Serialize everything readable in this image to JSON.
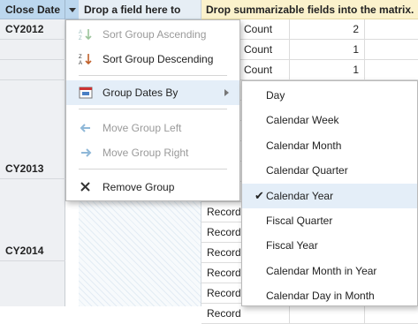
{
  "header": {
    "close_date": "Close Date",
    "drop_field": "Drop a field here to",
    "drop_summarizable": "Drop summarizable fields into the matrix."
  },
  "years": [
    "CY2012",
    "CY2013",
    "CY2014"
  ],
  "records": [
    {
      "label": "Record Count",
      "value": "2"
    },
    {
      "label": "Record Count",
      "value": "1"
    },
    {
      "label": "Record Count",
      "value": "1"
    },
    {
      "label": "Record Count",
      "value": ""
    },
    {
      "label": "Record Count",
      "value": ""
    },
    {
      "label": "Record Count",
      "value": ""
    },
    {
      "label": "Record Count",
      "value": ""
    },
    {
      "label": "Record Count",
      "value": ""
    },
    {
      "label": "Record Count",
      "value": ""
    },
    {
      "label": "Record Count",
      "value": ""
    },
    {
      "label": "Record",
      "value": ""
    },
    {
      "label": "Record",
      "value": ""
    },
    {
      "label": "Record",
      "value": ""
    },
    {
      "label": "Record",
      "value": ""
    },
    {
      "label": "Record",
      "value": ""
    }
  ],
  "context_menu": {
    "sort_asc": "Sort Group Ascending",
    "sort_desc": "Sort Group Descending",
    "group_dates_by": "Group Dates By",
    "move_left": "Move Group Left",
    "move_right": "Move Group Right",
    "remove": "Remove Group"
  },
  "submenu": {
    "items": [
      "Day",
      "Calendar Week",
      "Calendar Month",
      "Calendar Quarter",
      "Calendar Year",
      "Fiscal Quarter",
      "Fiscal Year",
      "Calendar Month in Year",
      "Calendar Day in Month"
    ],
    "selected": "Calendar Year"
  },
  "colors": {
    "header_blue": "#bcd7ee",
    "header_yellow": "#fbf2cc",
    "menu_highlight": "#e4eef8"
  },
  "icons": [
    "sort-ascending-icon",
    "sort-descending-icon",
    "calendar-icon",
    "arrow-left-icon",
    "arrow-right-icon",
    "remove-x-icon",
    "submenu-arrow-icon",
    "checkmark-icon"
  ]
}
